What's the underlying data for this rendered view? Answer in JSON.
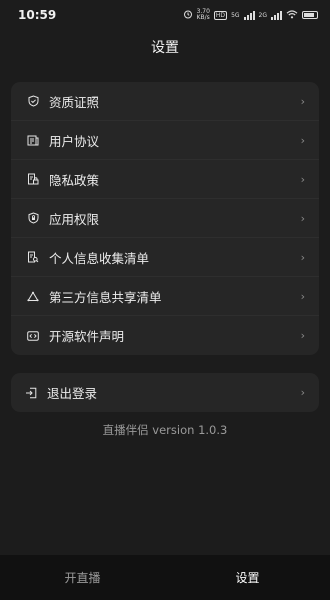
{
  "status_bar": {
    "time": "10:59",
    "net_speed_value": "3.70",
    "net_speed_unit": "KB/s",
    "hd_badge": "HD",
    "net_5g": "5G",
    "net_2g": "2G"
  },
  "header": {
    "title": "设置"
  },
  "menu": {
    "items": [
      {
        "label": "资质证照",
        "icon": "shield-check-icon"
      },
      {
        "label": "用户协议",
        "icon": "document-list-icon"
      },
      {
        "label": "隐私政策",
        "icon": "document-lock-icon"
      },
      {
        "label": "应用权限",
        "icon": "shield-lock-icon"
      },
      {
        "label": "个人信息收集清单",
        "icon": "document-search-icon"
      },
      {
        "label": "第三方信息共享清单",
        "icon": "share-triangle-icon"
      },
      {
        "label": "开源软件声明",
        "icon": "code-box-icon"
      }
    ]
  },
  "logout": {
    "label": "退出登录",
    "icon": "logout-icon"
  },
  "version_text": "直播伴侣 version 1.0.3",
  "tabs": [
    {
      "label": "开直播",
      "active": false
    },
    {
      "label": "设置",
      "active": true
    }
  ],
  "colors": {
    "background": "#1c1c1c",
    "card": "#262626",
    "tab_bar": "#111111",
    "text_primary": "#ececec",
    "text_secondary": "#9a9a9a"
  }
}
